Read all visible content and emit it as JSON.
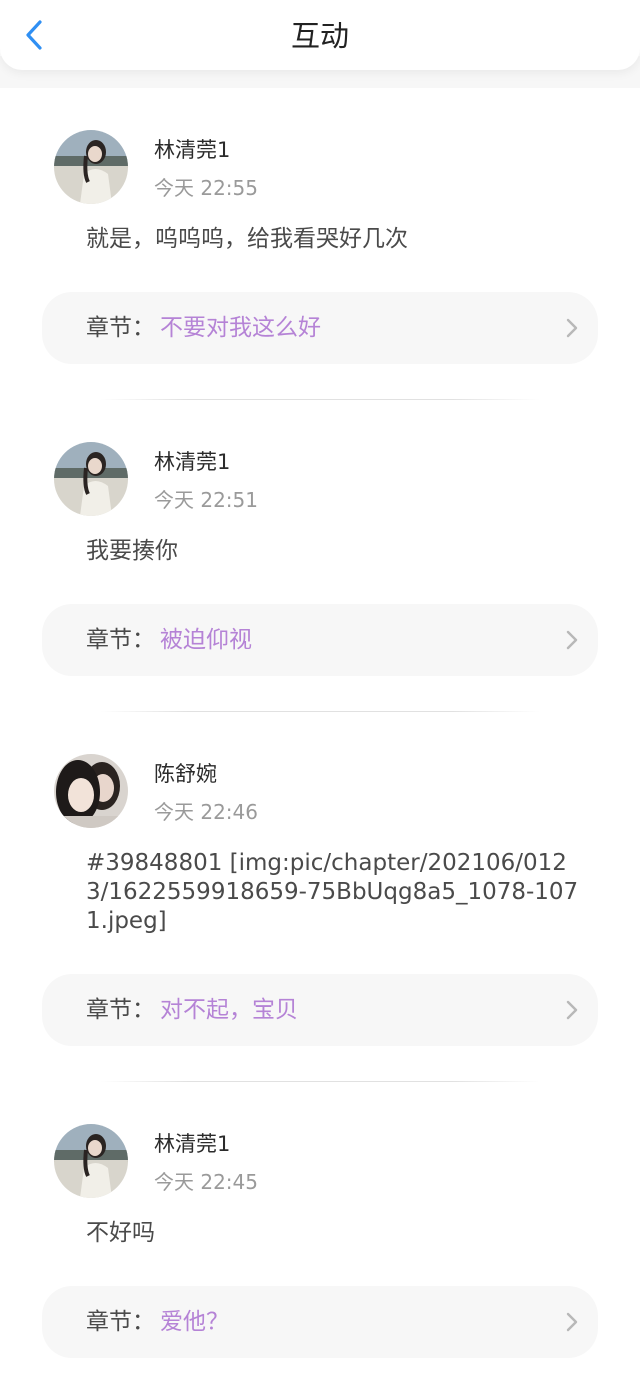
{
  "header": {
    "title": "互动",
    "back_icon": "chevron-left-icon"
  },
  "colors": {
    "accent_blue": "#2f8ff3",
    "chapter_link": "#b583d6",
    "text_primary": "#2b2b2b",
    "text_secondary": "#9a9a9a",
    "card_bg": "#f7f7f7"
  },
  "comments": [
    {
      "username": "林清莞1",
      "time": "今天 22:55",
      "content": "就是，呜呜呜，给我看哭好几次",
      "chapter_prefix": "章节：",
      "chapter_title": "不要对我这么好"
    },
    {
      "username": "林清莞1",
      "time": "今天 22:51",
      "content": "我要揍你",
      "chapter_prefix": "章节：",
      "chapter_title": "被迫仰视"
    },
    {
      "username": "陈舒婉",
      "time": "今天 22:46",
      "content": "#39848801 [img:pic/chapter/202106/0123/1622559918659-75BbUqg8a5_1078-1071.jpeg]",
      "chapter_prefix": "章节：",
      "chapter_title": "对不起，宝贝"
    },
    {
      "username": "林清莞1",
      "time": "今天 22:45",
      "content": "不好吗",
      "chapter_prefix": "章节：",
      "chapter_title": "爱他？"
    }
  ]
}
